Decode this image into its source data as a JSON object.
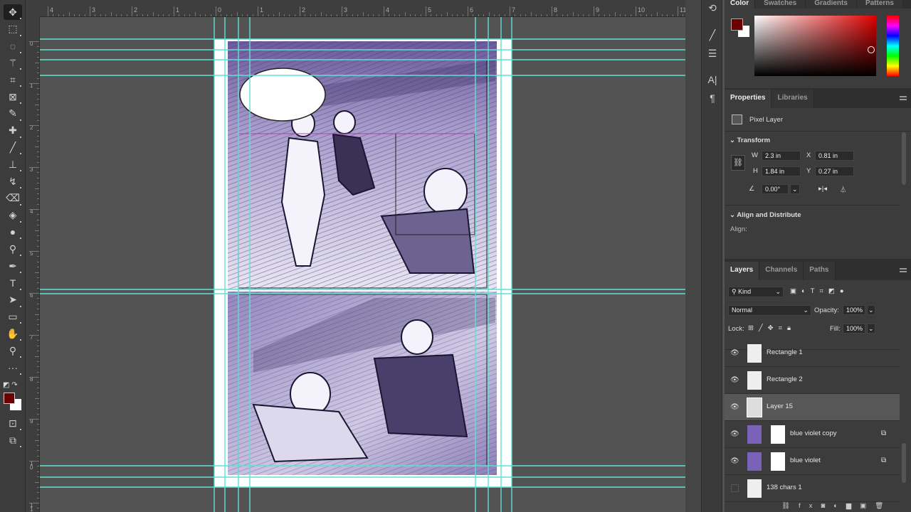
{
  "toolbar": {
    "tools": [
      {
        "name": "move-tool",
        "glyph": "✥"
      },
      {
        "name": "marquee-tool",
        "glyph": "⬚"
      },
      {
        "name": "lasso-tool",
        "glyph": "◌"
      },
      {
        "name": "magic-wand-tool",
        "glyph": "⚚"
      },
      {
        "name": "crop-tool",
        "glyph": "⌗"
      },
      {
        "name": "frame-tool",
        "glyph": "⊠"
      },
      {
        "name": "eyedropper-tool",
        "glyph": "✎"
      },
      {
        "name": "healing-brush-tool",
        "glyph": "✚"
      },
      {
        "name": "brush-tool",
        "glyph": "╱"
      },
      {
        "name": "clone-stamp-tool",
        "glyph": "⊥"
      },
      {
        "name": "history-brush-tool",
        "glyph": "↯"
      },
      {
        "name": "eraser-tool",
        "glyph": "⌫"
      },
      {
        "name": "paint-bucket-tool",
        "glyph": "◈"
      },
      {
        "name": "blur-tool",
        "glyph": "●"
      },
      {
        "name": "dodge-tool",
        "glyph": "⚲"
      },
      {
        "name": "pen-tool",
        "glyph": "✒"
      },
      {
        "name": "type-tool",
        "glyph": "T"
      },
      {
        "name": "path-selection-tool",
        "glyph": "➤"
      },
      {
        "name": "rectangle-tool",
        "glyph": "▭"
      },
      {
        "name": "hand-tool",
        "glyph": "✋"
      },
      {
        "name": "zoom-tool",
        "glyph": "⚲"
      },
      {
        "name": "more-tools",
        "glyph": "···"
      }
    ],
    "foreground_color": "#6b0000",
    "background_color": "#ffffff"
  },
  "rulers": {
    "top": [
      "4",
      "3",
      "2",
      "1",
      "0",
      "1",
      "2",
      "3",
      "4",
      "5",
      "6",
      "7",
      "8",
      "9",
      "10",
      "11"
    ],
    "left": [
      "0",
      "1",
      "2",
      "3",
      "4",
      "5",
      "6",
      "7",
      "8",
      "9",
      "10",
      "11"
    ]
  },
  "color_panel": {
    "tabs": [
      "Color",
      "Swatches",
      "Gradients",
      "Patterns"
    ],
    "foreground": "#6b0000",
    "hue": "#e00000"
  },
  "properties": {
    "tabs": [
      "Properties",
      "Libraries"
    ],
    "layer_type": "Pixel Layer",
    "transform": {
      "title": "Transform",
      "w_label": "W",
      "w": "2.3 in",
      "h_label": "H",
      "h": "1.84 in",
      "x_label": "X",
      "x": "0.81 in",
      "y_label": "Y",
      "y": "0.27 in",
      "angle": "0.00°"
    },
    "align": {
      "title": "Align and Distribute",
      "label": "Align:"
    }
  },
  "layers_panel": {
    "tabs": [
      "Layers",
      "Channels",
      "Paths"
    ],
    "filter": "Kind",
    "blend_mode": "Normal",
    "opacity_label": "Opacity:",
    "opacity": "100%",
    "lock_label": "Lock:",
    "fill_label": "Fill:",
    "fill": "100%",
    "layers": [
      {
        "name": "Rectangle 1",
        "visible": true,
        "kind": "shape"
      },
      {
        "name": "Rectangle 2",
        "visible": true,
        "kind": "shape"
      },
      {
        "name": "Layer 15",
        "visible": true,
        "kind": "pixel",
        "selected": true
      },
      {
        "name": "blue violet copy",
        "visible": true,
        "kind": "adjust"
      },
      {
        "name": "blue violet",
        "visible": true,
        "kind": "adjust"
      },
      {
        "name": "138 chars 1",
        "visible": false,
        "kind": "smart"
      }
    ]
  }
}
